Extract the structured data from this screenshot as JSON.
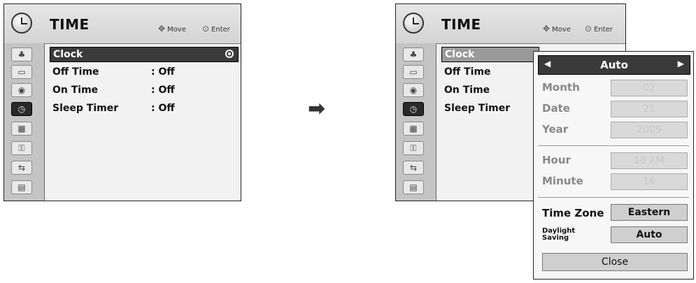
{
  "left_panel": {
    "title": "TIME",
    "hint_move": "Move",
    "hint_enter": "Enter",
    "items": [
      {
        "label": "Clock",
        "value": ""
      },
      {
        "label": "Off Time",
        "value": ": Off"
      },
      {
        "label": "On Time",
        "value": ": Off"
      },
      {
        "label": "Sleep Timer",
        "value": ": Off"
      }
    ]
  },
  "right_panel": {
    "title": "TIME",
    "hint_move": "Move",
    "hint_enter": "Enter",
    "items": [
      {
        "label": "Clock"
      },
      {
        "label": "Off Time"
      },
      {
        "label": "On Time"
      },
      {
        "label": "Sleep Timer"
      }
    ]
  },
  "arrow": "➡",
  "popup": {
    "mode": "Auto",
    "month_label": "Month",
    "month_value": "02",
    "date_label": "Date",
    "date_value": "21",
    "year_label": "Year",
    "year_value": "2009",
    "hour_label": "Hour",
    "hour_value": "10 AM",
    "minute_label": "Minute",
    "minute_value": "16",
    "timezone_label": "Time Zone",
    "timezone_value": "Eastern",
    "daylight_label_1": "Daylight",
    "daylight_label_2": "Saving",
    "daylight_value": "Auto",
    "close_label": "Close"
  }
}
